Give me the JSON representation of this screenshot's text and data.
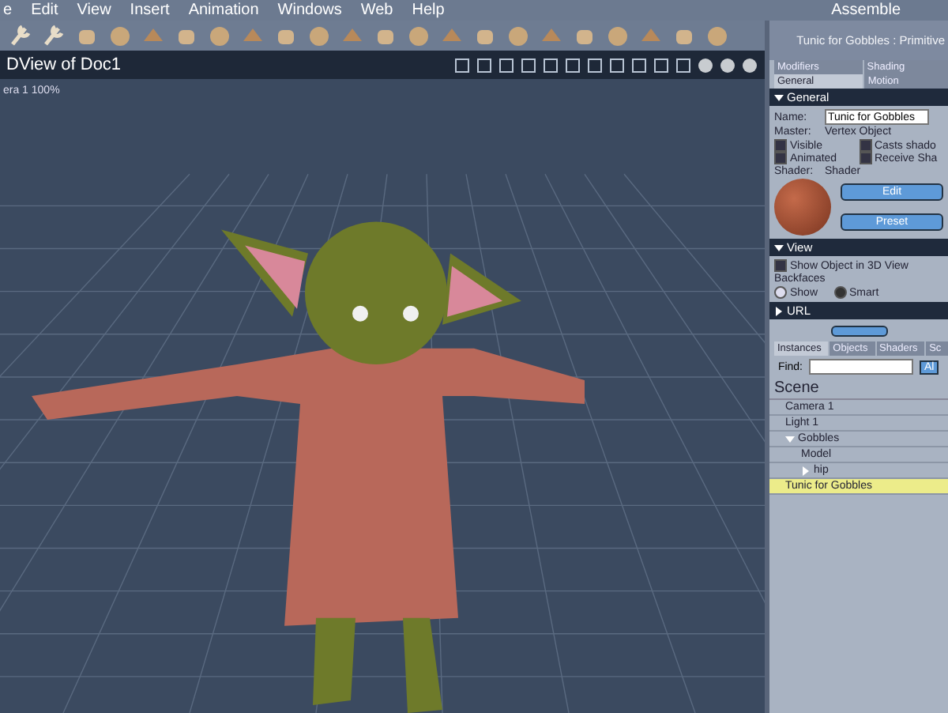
{
  "menu_bar": {
    "items": [
      "e",
      "Edit",
      "View",
      "Insert",
      "Animation",
      "Windows",
      "Web",
      "Help"
    ],
    "room": "Assemble"
  },
  "viewport": {
    "title": "DView of Doc1",
    "camera_label": "era 1 100%"
  },
  "properties": {
    "title": "Tunic for Gobbles : Primitive",
    "tabs_top": [
      {
        "label": "Modifiers",
        "selected": false
      },
      {
        "label": "Shading",
        "selected": false
      }
    ],
    "tabs": [
      {
        "label": "General",
        "selected": true
      },
      {
        "label": "Motion",
        "selected": false
      }
    ],
    "general": {
      "header": "General",
      "expanded": true,
      "name_label": "Name:",
      "name_value": "Tunic for Gobbles",
      "master_label": "Master:",
      "master_value": "Vertex Object",
      "checkboxes": [
        {
          "label": "Visible",
          "checked": true
        },
        {
          "label": "Casts shado",
          "checked": true
        },
        {
          "label": "Animated",
          "checked": true
        },
        {
          "label": "Receive Sha",
          "checked": true
        }
      ],
      "shader_label": "Shader:",
      "shader_value": "Shader",
      "buttons": [
        "Edit",
        "Preset"
      ]
    },
    "view": {
      "header": "View",
      "expanded": true,
      "show_checkbox": {
        "label": "Show Object in 3D View",
        "checked": true
      },
      "backfaces_label": "Backfaces",
      "radios": [
        {
          "label": "Show",
          "selected": false
        },
        {
          "label": "Smart",
          "selected": true
        }
      ]
    },
    "url": {
      "header": "URL",
      "expanded": false
    }
  },
  "browser": {
    "tabs": [
      {
        "label": "Instances",
        "selected": true
      },
      {
        "label": "Objects",
        "selected": false
      },
      {
        "label": "Shaders",
        "selected": false
      },
      {
        "label": "Sc",
        "selected": false
      }
    ],
    "find_label": "Find:",
    "find_button": "Al",
    "scene_label": "Scene",
    "tree": [
      {
        "label": "Camera 1",
        "selected": false
      },
      {
        "label": "Light 1",
        "selected": false
      },
      {
        "label": "Gobbles",
        "selected": false,
        "expanded": true,
        "children": [
          {
            "label": "Model",
            "selected": false
          },
          {
            "label": "hip",
            "selected": false,
            "expanded": false
          }
        ]
      },
      {
        "label": "Tunic for Gobbles",
        "selected": true
      }
    ]
  }
}
